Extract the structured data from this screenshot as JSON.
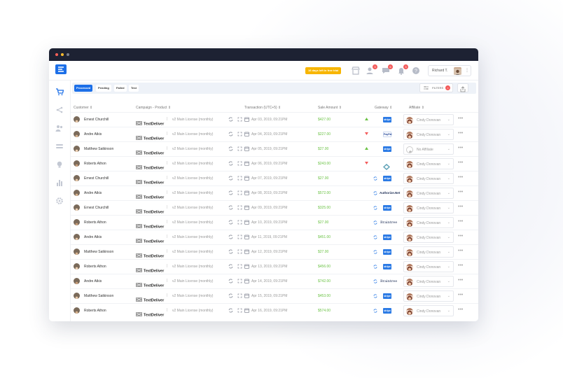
{
  "trial_banner": "16 days left in free trial",
  "user": {
    "name": "Richard T."
  },
  "notifications": {
    "users_badge": "3",
    "messages_badge": "6",
    "alerts_badge": "3"
  },
  "tabs": [
    {
      "label": "Processed",
      "active": true
    },
    {
      "label": "Pending",
      "active": false
    },
    {
      "label": "Failed",
      "active": false
    },
    {
      "label": "Test",
      "active": false
    }
  ],
  "filters_label": "FILTERS",
  "filters_clear": "×",
  "headers": {
    "customer": "Customer ⇕",
    "campaign": "Campaign - Product ⇕",
    "transaction": "Transaction (UTC+5) ⇕",
    "amount": "Sale Amount ⇕",
    "gateway": "Gateway ⇕",
    "affiliate": "Affiliate ⇕"
  },
  "product_logo": "TextDeliver",
  "separator": "|",
  "more": "•••",
  "chevron": "⌄",
  "colors": {
    "accent": "#1c6fe8",
    "amount": "#6ac244",
    "badge": "#f35b5b",
    "trial": "#f7b500"
  },
  "rows": [
    {
      "customer": "Ernest Churchill",
      "product": "v2 Main License (monthly)",
      "date": "Apr 03, 2019, 09:21PM",
      "amount": "$427.00",
      "flag": "up",
      "gateway": "stripe",
      "affiliate": "Cindy Donovan"
    },
    {
      "customer": "Andre Atkis",
      "product": "v2 Main License (monthly)",
      "date": "Apr 04, 2019, 09:21PM",
      "amount": "$227.00",
      "flag": "down",
      "gateway": "PayPal",
      "affiliate": "Cindy Donovan"
    },
    {
      "customer": "Matthew Satkinson",
      "product": "v2 Main License (monthly)",
      "date": "Apr 05, 2019, 09:21PM",
      "amount": "$27.00",
      "flag": "up",
      "gateway": "stripe",
      "affiliate": "No Affiliate"
    },
    {
      "customer": "Roberts Athon",
      "product": "v2 Main License (monthly)",
      "date": "Apr 06, 2019, 09:21PM",
      "amount": "$243.00",
      "flag": "down",
      "gateway": "other",
      "affiliate": "Cindy Donovan"
    },
    {
      "customer": "Ernest Churchill",
      "product": "v2 Main License (monthly)",
      "date": "Apr 07, 2019, 09:21PM",
      "amount": "$27.00",
      "flag": "",
      "gateway": "stripe",
      "affiliate": "Cindy Donovan"
    },
    {
      "customer": "Andre Atkis",
      "product": "v2 Main License (monthly)",
      "date": "Apr 08, 2019, 09:21PM",
      "amount": "$572.00",
      "flag": "",
      "gateway": "Authorize.Net",
      "affiliate": "Cindy Donovan"
    },
    {
      "customer": "Ernest Churchill",
      "product": "v2 Main License (monthly)",
      "date": "Apr 09, 2019, 09:21PM",
      "amount": "$325.00",
      "flag": "",
      "gateway": "stripe",
      "affiliate": "Cindy Donovan"
    },
    {
      "customer": "Roberts Athon",
      "product": "v2 Main License (monthly)",
      "date": "Apr 10, 2019, 09:21PM",
      "amount": "$27.00",
      "flag": "",
      "gateway": "Braintree",
      "affiliate": "Cindy Donovan"
    },
    {
      "customer": "Andre Atkis",
      "product": "v2 Main License (monthly)",
      "date": "Apr 11, 2019, 09:21PM",
      "amount": "$451.00",
      "flag": "",
      "gateway": "stripe",
      "affiliate": "Cindy Donovan"
    },
    {
      "customer": "Matthew Satkinson",
      "product": "v2 Main License (monthly)",
      "date": "Apr 12, 2019, 09:21PM",
      "amount": "$27.00",
      "flag": "",
      "gateway": "stripe",
      "affiliate": "Cindy Donovan"
    },
    {
      "customer": "Roberts Athon",
      "product": "v2 Main License (monthly)",
      "date": "Apr 13, 2019, 09:21PM",
      "amount": "$456.00",
      "flag": "",
      "gateway": "stripe",
      "affiliate": "Cindy Donovan"
    },
    {
      "customer": "Andre Atkis",
      "product": "v2 Main License (monthly)",
      "date": "Apr 14, 2019, 09:21PM",
      "amount": "$742.00",
      "flag": "",
      "gateway": "Braintree",
      "affiliate": "Cindy Donovan"
    },
    {
      "customer": "Matthew Satkinson",
      "product": "v2 Main License (monthly)",
      "date": "Apr 15, 2019, 09:21PM",
      "amount": "$453.00",
      "flag": "",
      "gateway": "stripe",
      "affiliate": "Cindy Donovan"
    },
    {
      "customer": "Roberts Athon",
      "product": "v2 Main License (monthly)",
      "date": "Apr 16, 2019, 09:21PM",
      "amount": "$574.00",
      "flag": "",
      "gateway": "stripe",
      "affiliate": "Cindy Donovan"
    }
  ]
}
